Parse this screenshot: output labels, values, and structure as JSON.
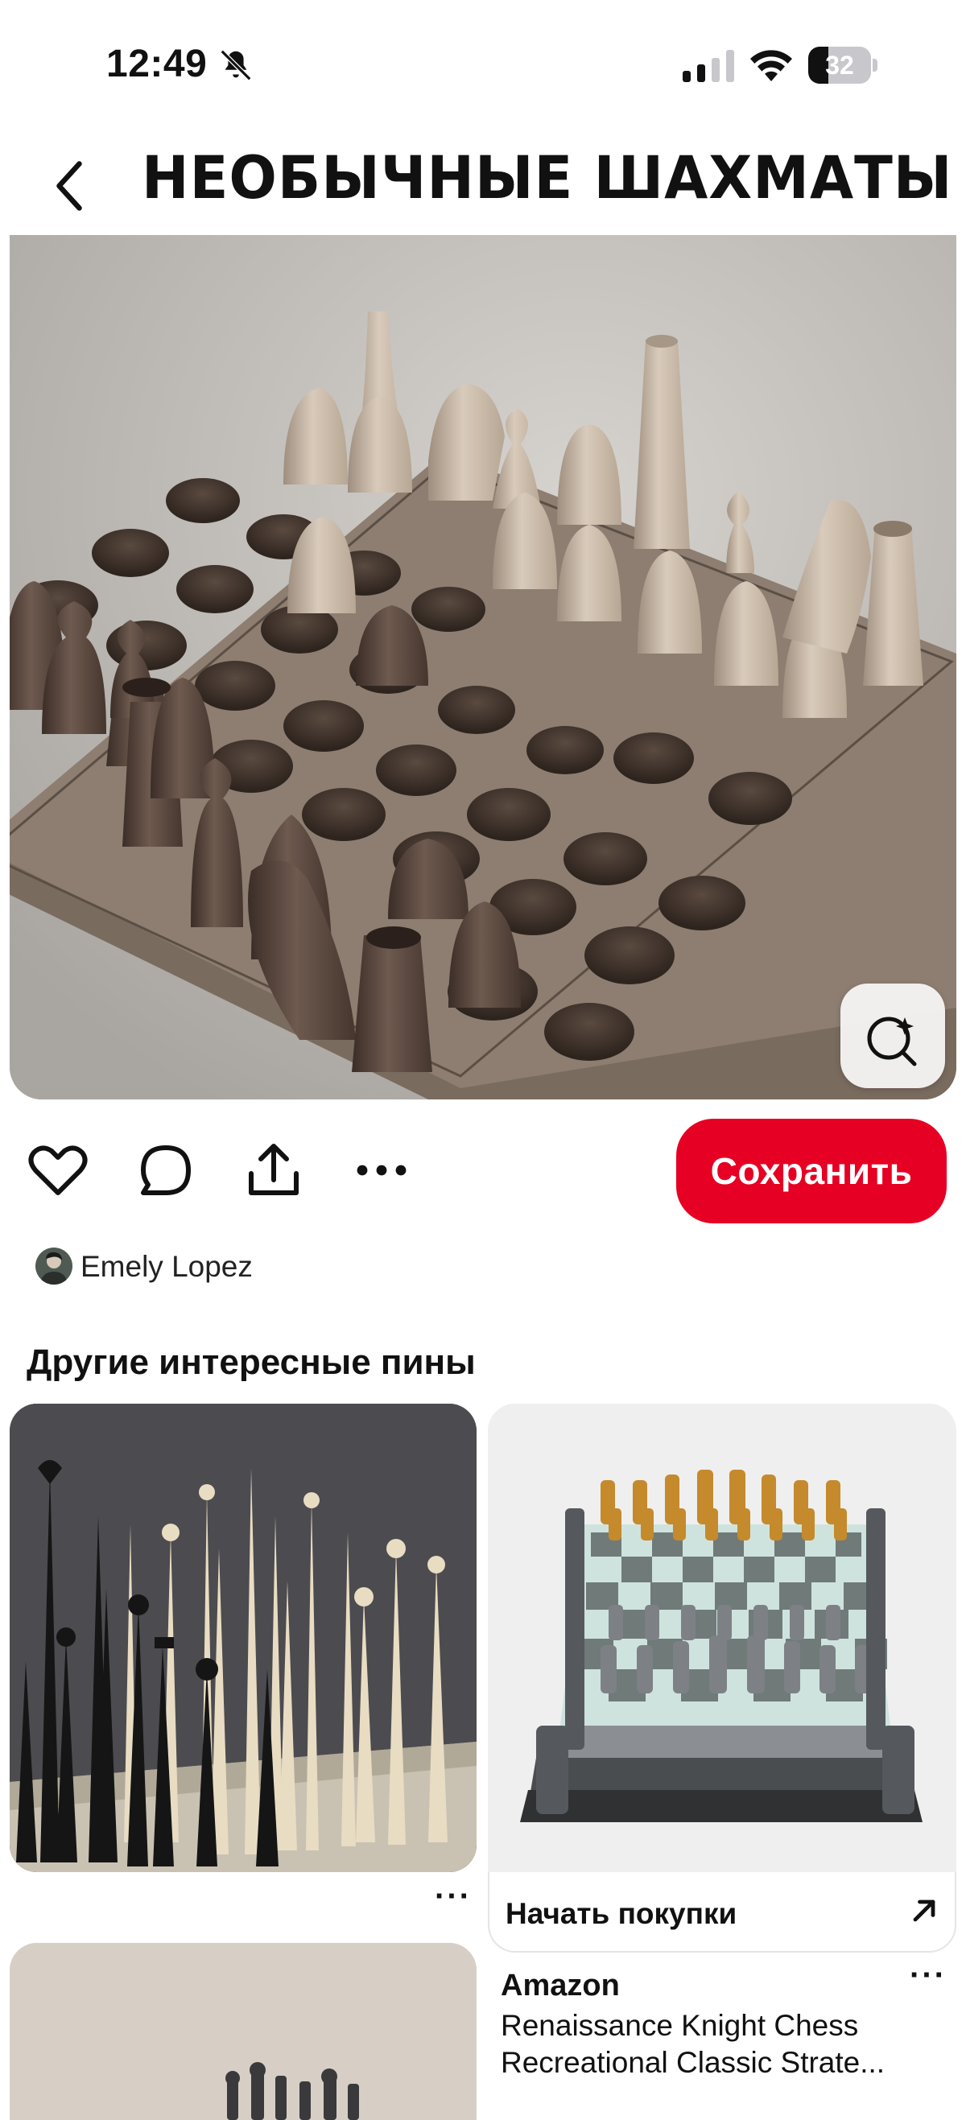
{
  "status_bar": {
    "time": "12:49",
    "battery_percent": "32",
    "battery_level": 0.32
  },
  "header": {
    "title": "НЕОБЫЧНЫЕ ШАХМАТЫ"
  },
  "pin": {
    "save_label": "Сохранить",
    "author": "Emely Lopez"
  },
  "related": {
    "heading": "Другие интересные пины",
    "more_label": "···",
    "shop_label": "Начать покупки",
    "merchant": "Amazon",
    "product_title_line1": "Renaissance Knight Chess",
    "product_title_line2": "Recreational Classic Strate..."
  },
  "colors": {
    "accent": "#e60023",
    "background": "#ffffff"
  }
}
